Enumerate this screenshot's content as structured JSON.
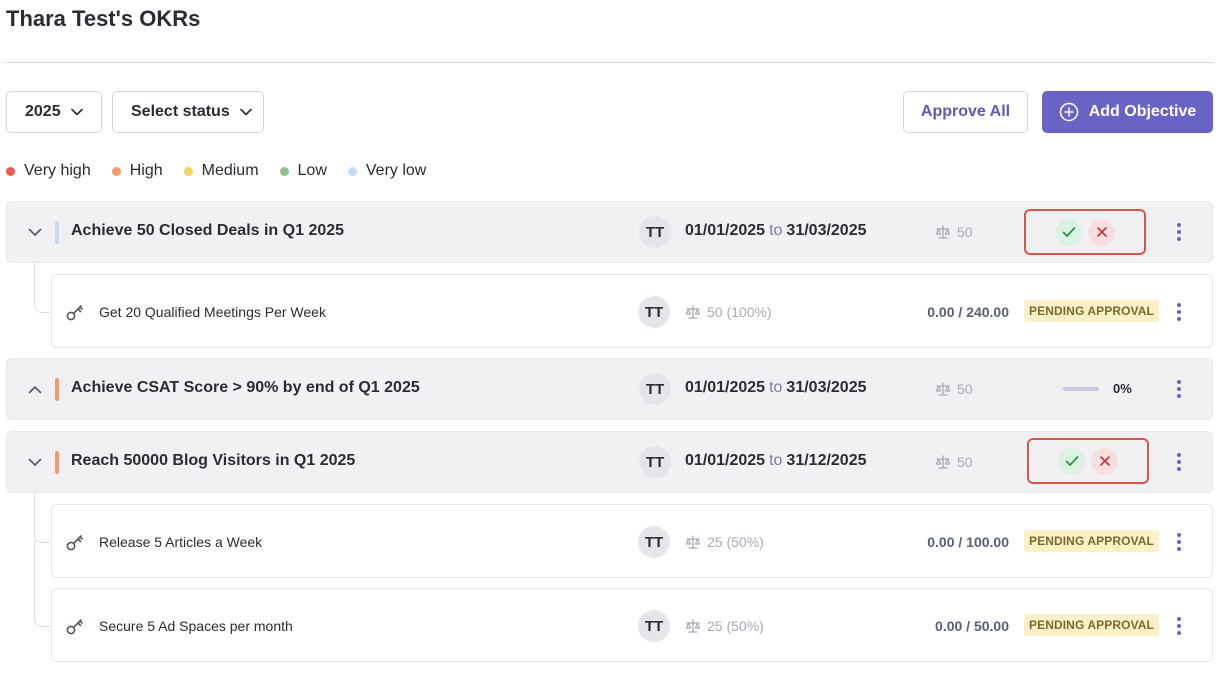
{
  "page": {
    "title": "Thara Test's OKRs"
  },
  "toolbar": {
    "year_value": "2025",
    "status_placeholder": "Select status",
    "approve_all_label": "Approve All",
    "add_objective_label": "Add Objective"
  },
  "legend": {
    "items": [
      {
        "label": "Very high",
        "color": "#e85a52"
      },
      {
        "label": "High",
        "color": "#f29a6a"
      },
      {
        "label": "Medium",
        "color": "#f2d55a"
      },
      {
        "label": "Low",
        "color": "#8fc28f"
      },
      {
        "label": "Very low",
        "color": "#c5dcf2"
      }
    ]
  },
  "objectives": [
    {
      "title": "Achieve 50 Closed Deals in Q1 2025",
      "owner": "TT",
      "start": "01/01/2025",
      "to": "to",
      "end": "31/03/2025",
      "weight": "50",
      "priority_color": "#c5dcf2",
      "expanded": true,
      "status": "approval",
      "key_results": [
        {
          "title": "Get 20 Qualified Meetings Per Week",
          "owner": "TT",
          "weight": "50 (100%)",
          "value": "0.00 / 240.00",
          "status": "PENDING APPROVAL"
        }
      ]
    },
    {
      "title": "Achieve CSAT Score > 90% by end of Q1 2025",
      "owner": "TT",
      "start": "01/01/2025",
      "to": "to",
      "end": "31/03/2025",
      "weight": "50",
      "priority_color": "#f29a6a",
      "expanded": false,
      "status": "progress",
      "progress": "0%",
      "key_results": []
    },
    {
      "title": "Reach 50000 Blog Visitors in Q1 2025",
      "owner": "TT",
      "start": "01/01/2025",
      "to": "to",
      "end": "31/12/2025",
      "weight": "50",
      "priority_color": "#f29a6a",
      "expanded": true,
      "status": "approval",
      "key_results": [
        {
          "title": "Release 5 Articles a Week",
          "owner": "TT",
          "weight": "25 (50%)",
          "value": "0.00 / 100.00",
          "status": "PENDING APPROVAL"
        },
        {
          "title": "Secure 5 Ad Spaces per month",
          "owner": "TT",
          "weight": "25 (50%)",
          "value": "0.00 / 50.00",
          "status": "PENDING APPROVAL"
        }
      ]
    }
  ]
}
